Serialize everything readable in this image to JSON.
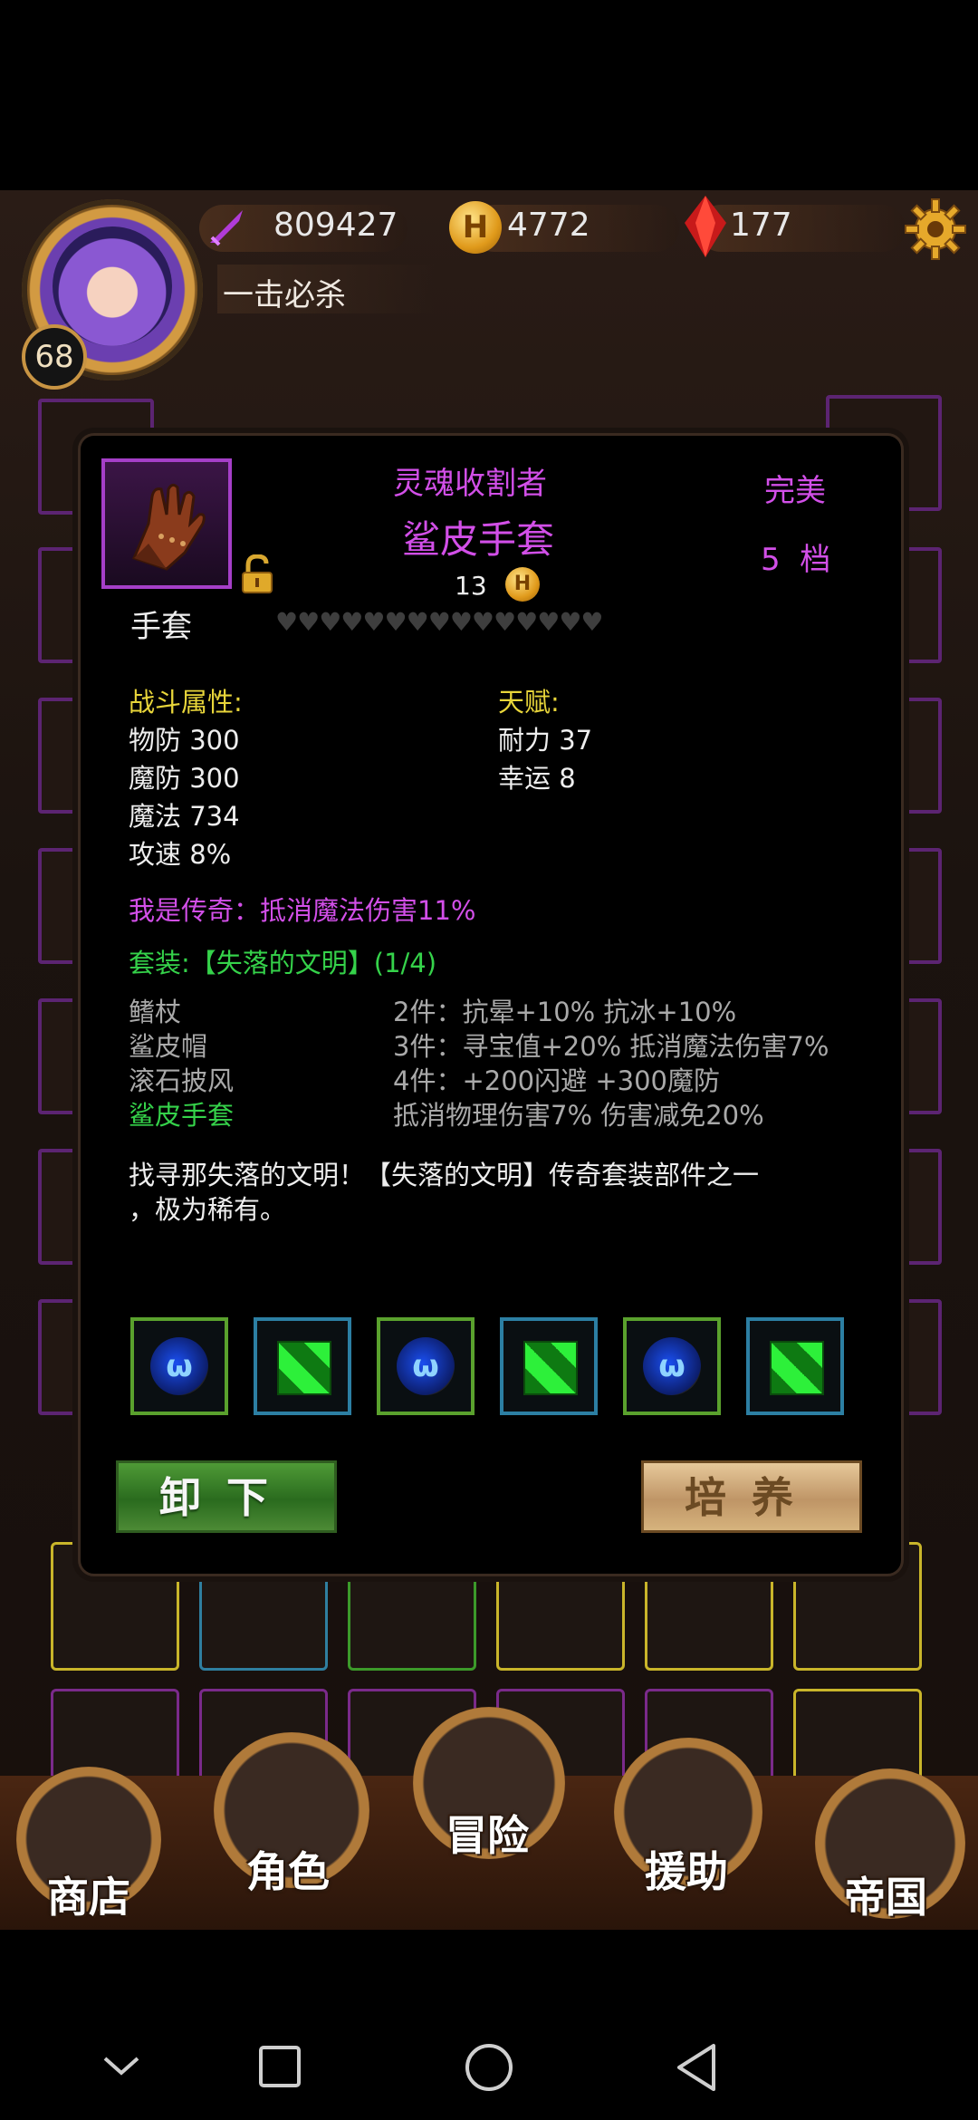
{
  "header": {
    "level": "68",
    "power": "809427",
    "gold": "4772",
    "gems": "177",
    "player_title": "一击必杀"
  },
  "item": {
    "set_prefix": "灵魂收割者",
    "name": "鲨皮手套",
    "quality": "完美",
    "grade": "5  档",
    "price": "13",
    "type": "手套",
    "hearts": "♥♥♥♥♥♥♥♥♥♥♥♥♥♥♥",
    "combat_label": "战斗属性:",
    "combat_stats": [
      "物防 300",
      "魔防 300",
      "魔法 734",
      "攻速 8%"
    ],
    "talent_label": "天赋:",
    "talent_stats": [
      "耐力 37",
      "幸运 8"
    ],
    "legend_line": "我是传奇：抵消魔法伤害11%",
    "set_line": "套装:【失落的文明】(1/4)",
    "set_pieces": [
      "鳍杖",
      "鲨皮帽",
      "滚石披风",
      "鲨皮手套"
    ],
    "set_bonuses": [
      "2件：抗晕+10% 抗冰+10%",
      "3件：寻宝值+20% 抵消魔法伤害7%",
      "4件：+200闪避 +300魔防",
      "抵消物理伤害7% 伤害减免20%"
    ],
    "description_1": "找寻那失落的文明！【失落的文明】传奇套装部件之一",
    "description_2": "，极为稀有。"
  },
  "buttons": {
    "unequip": "卸下",
    "train": "培养"
  },
  "nav": {
    "shop": "商店",
    "character": "角色",
    "adventure": "冒险",
    "assist": "援助",
    "empire": "帝国"
  },
  "colors": {
    "purple": "#d24fe8",
    "yellow": "#e8d53a",
    "green": "#35d24a"
  }
}
